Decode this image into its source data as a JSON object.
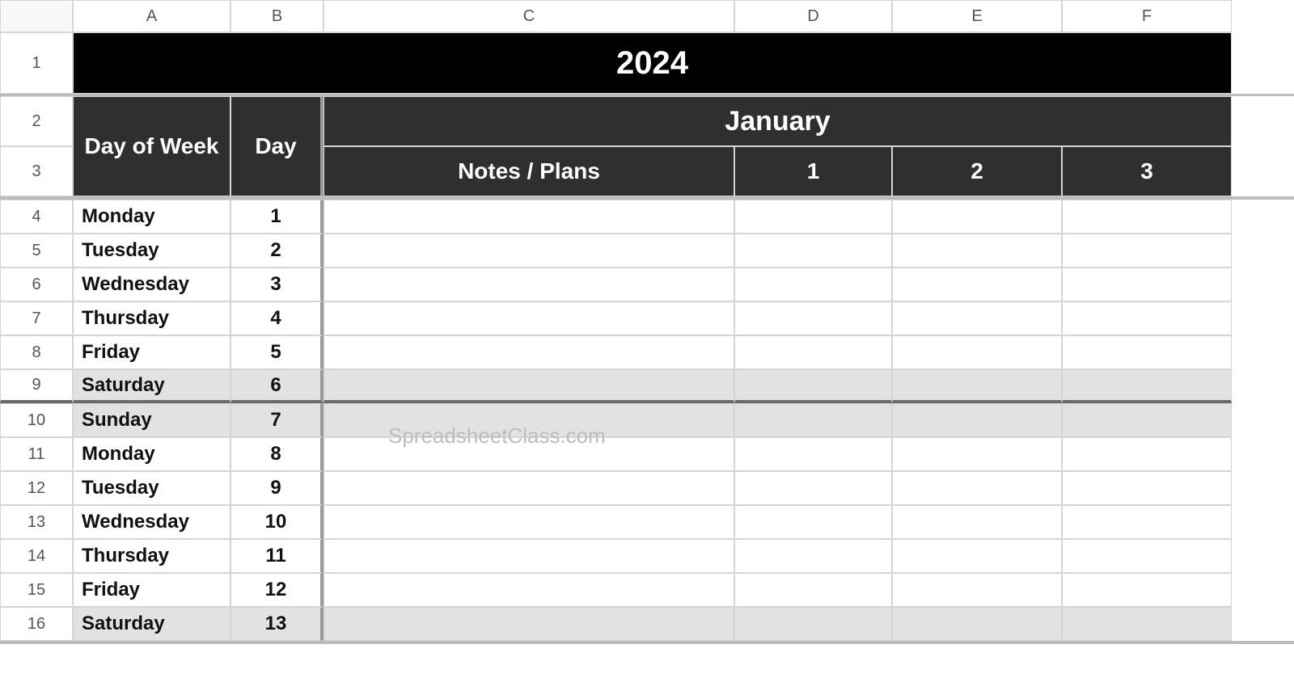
{
  "columns": [
    "A",
    "B",
    "C",
    "D",
    "E",
    "F"
  ],
  "row_numbers": [
    1,
    2,
    3,
    4,
    5,
    6,
    7,
    8,
    9,
    10,
    11,
    12,
    13,
    14,
    15,
    16
  ],
  "headers": {
    "year": "2024",
    "day_of_week": "Day of Week",
    "day": "Day",
    "month": "January",
    "notes": "Notes / Plans",
    "sub": [
      "1",
      "2",
      "3"
    ]
  },
  "rows": [
    {
      "dow": "Monday",
      "day": "1",
      "weekend": false
    },
    {
      "dow": "Tuesday",
      "day": "2",
      "weekend": false
    },
    {
      "dow": "Wednesday",
      "day": "3",
      "weekend": false
    },
    {
      "dow": "Thursday",
      "day": "4",
      "weekend": false
    },
    {
      "dow": "Friday",
      "day": "5",
      "weekend": false
    },
    {
      "dow": "Saturday",
      "day": "6",
      "weekend": true
    },
    {
      "dow": "Sunday",
      "day": "7",
      "weekend": true
    },
    {
      "dow": "Monday",
      "day": "8",
      "weekend": false
    },
    {
      "dow": "Tuesday",
      "day": "9",
      "weekend": false
    },
    {
      "dow": "Wednesday",
      "day": "10",
      "weekend": false
    },
    {
      "dow": "Thursday",
      "day": "11",
      "weekend": false
    },
    {
      "dow": "Friday",
      "day": "12",
      "weekend": false
    },
    {
      "dow": "Saturday",
      "day": "13",
      "weekend": true
    }
  ],
  "watermark": "SpreadsheetClass.com"
}
